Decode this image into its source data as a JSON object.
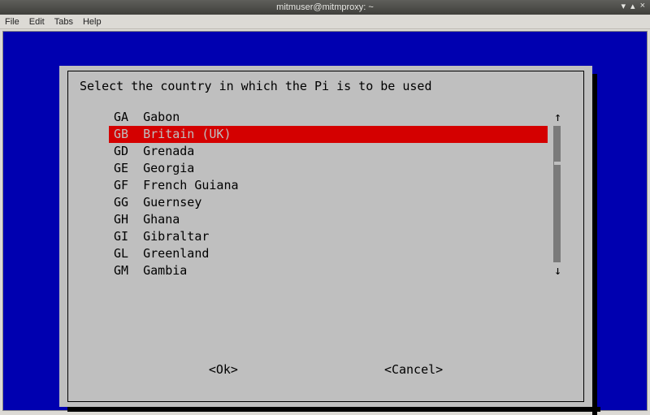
{
  "window": {
    "title": "mitmuser@mitmproxy: ~",
    "controls": {
      "min": "▾",
      "max": "▴",
      "close": "×"
    }
  },
  "menubar": {
    "items": [
      "File",
      "Edit",
      "Tabs",
      "Help"
    ]
  },
  "colors": {
    "terminal_bg": "#0000b0",
    "dialog_bg": "#bfbfbf",
    "highlight_bg": "#d40000"
  },
  "dialog": {
    "prompt": "Select the country in which the Pi is to be used",
    "selected_index": 1,
    "items": [
      {
        "code": "GA",
        "name": "Gabon"
      },
      {
        "code": "GB",
        "name": "Britain (UK)"
      },
      {
        "code": "GD",
        "name": "Grenada"
      },
      {
        "code": "GE",
        "name": "Georgia"
      },
      {
        "code": "GF",
        "name": "French Guiana"
      },
      {
        "code": "GG",
        "name": "Guernsey"
      },
      {
        "code": "GH",
        "name": "Ghana"
      },
      {
        "code": "GI",
        "name": "Gibraltar"
      },
      {
        "code": "GL",
        "name": "Greenland"
      },
      {
        "code": "GM",
        "name": "Gambia"
      }
    ],
    "scroll": {
      "up": "↑",
      "down": "↓",
      "gap_after_index": 3
    },
    "buttons": {
      "ok": "<Ok>",
      "cancel": "<Cancel>"
    }
  }
}
